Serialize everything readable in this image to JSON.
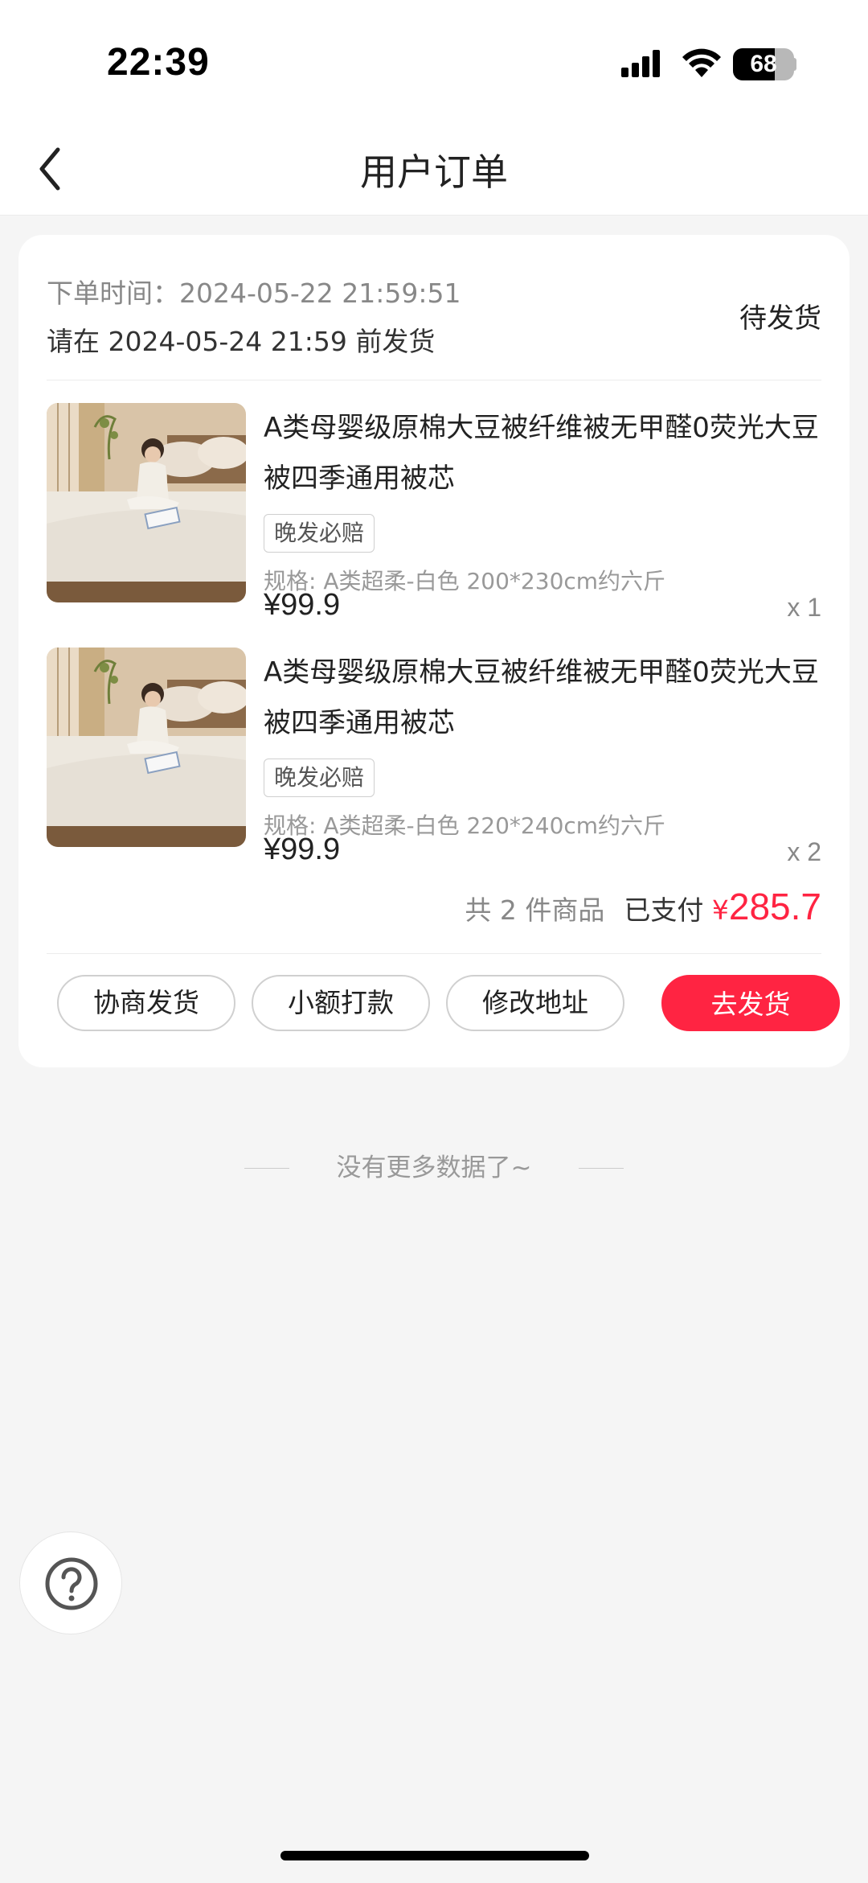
{
  "status_bar": {
    "time": "22:39",
    "battery_level": "68",
    "battery_fraction": 0.68,
    "icons": [
      "signal-icon",
      "wifi-icon",
      "battery-icon"
    ]
  },
  "nav": {
    "title": "用户订单",
    "back_icon": "chevron-left-icon"
  },
  "order": {
    "order_time_label": "下单时间：",
    "order_time": "2024-05-22 21:59:51",
    "ship_deadline": "请在 2024-05-24 21:59 前发货",
    "status": "待发货",
    "items": [
      {
        "title": "A类母婴级原棉大豆被纤维被无甲醛0荧光大豆被四季通用被芯",
        "tag": "晚发必赔",
        "spec": "规格: A类超柔-白色 200*230cm约六斤",
        "price": "¥99.9",
        "quantity": "x 1"
      },
      {
        "title": "A类母婴级原棉大豆被纤维被无甲醛0荧光大豆被四季通用被芯",
        "tag": "晚发必赔",
        "spec": "规格: A类超柔-白色 220*240cm约六斤",
        "price": "¥99.9",
        "quantity": "x 2"
      }
    ],
    "summary": {
      "count": "共 2 件商品",
      "paid_label": "已支付",
      "currency": "¥",
      "amount": "285.7"
    },
    "actions": [
      "协商发货",
      "小额打款",
      "修改地址",
      "去发货"
    ]
  },
  "footer": {
    "no_more": "没有更多数据了~",
    "help_icon": "question-circle-icon"
  },
  "colors": {
    "accent": "#ff2442",
    "background": "#f5f5f5",
    "card": "#ffffff"
  }
}
